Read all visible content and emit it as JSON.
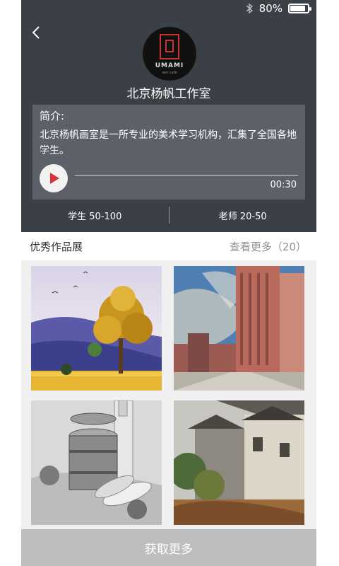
{
  "status_bar": {
    "battery": "80%",
    "battery_level": 0.8
  },
  "profile": {
    "logo_brand": "UMAMI",
    "logo_sub": "zen café",
    "name": "北京杨帆工作室",
    "intro_label": "简介:",
    "intro_text": "北京杨帆画室是一所专业的美术学习机构，汇集了全国各地学生。",
    "audio_time": "00:30",
    "audio_progress": 0,
    "stats": {
      "students": "学生 50-100",
      "teachers": "老师 20-50"
    }
  },
  "works": {
    "title": "优秀作品展",
    "more": "查看更多（20）",
    "items": [
      {
        "subject": "autumn tree landscape"
      },
      {
        "subject": "city buildings painting"
      },
      {
        "subject": "still life sketch"
      },
      {
        "subject": "old village house painting"
      }
    ]
  },
  "cta": {
    "label": "获取更多"
  },
  "colors": {
    "header_bg": "#3b3f46",
    "intro_bg": "#5c6068",
    "play_red": "#d9343a",
    "cta_bg": "#bdbdbd"
  }
}
